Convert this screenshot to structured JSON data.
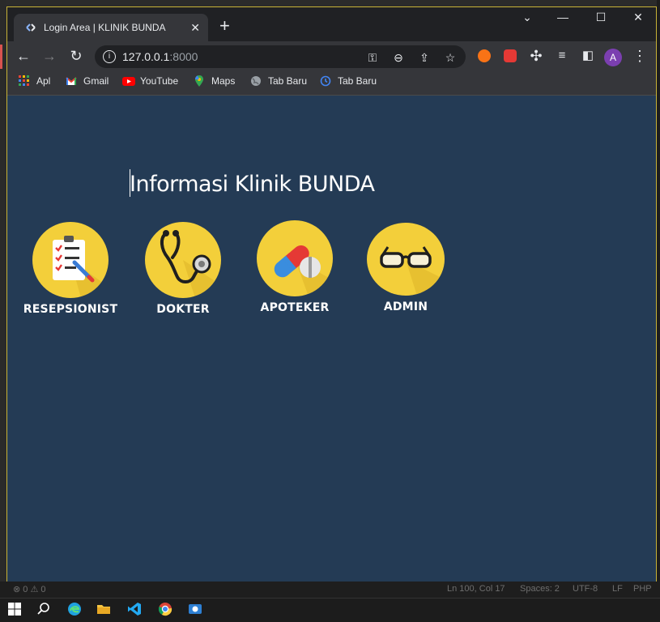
{
  "browser": {
    "tab_title": "Login Area | KLINIK BUNDA",
    "new_tab": "+",
    "url_host": "127.0.0.1",
    "url_port": ":8000",
    "profile_initial": "A"
  },
  "bookmarks": [
    {
      "label": "Apl",
      "icon": "apps-grid-icon"
    },
    {
      "label": "Gmail",
      "icon": "gmail-icon"
    },
    {
      "label": "YouTube",
      "icon": "youtube-icon"
    },
    {
      "label": "Maps",
      "icon": "maps-icon"
    },
    {
      "label": "Tab Baru",
      "icon": "globe-icon"
    },
    {
      "label": "Tab Baru",
      "icon": "history-icon"
    }
  ],
  "page": {
    "title": "Informasi Klinik BUNDA",
    "roles": [
      {
        "label": "RESEPSIONIST",
        "icon": "clipboard-checklist-icon"
      },
      {
        "label": "DOKTER",
        "icon": "stethoscope-icon"
      },
      {
        "label": "APOTEKER",
        "icon": "pill-capsule-icon"
      },
      {
        "label": "ADMIN",
        "icon": "glasses-icon"
      }
    ]
  },
  "statusbar": {
    "left": "⊗ 0 ⚠ 0",
    "position": "Ln 100, Col 17",
    "spaces": "Spaces: 2",
    "encoding": "UTF-8",
    "eol": "LF",
    "language": "PHP"
  },
  "colors": {
    "page_background": "#243b55",
    "icon_circle": "#f3cf3a",
    "browser_frame": "#202124"
  }
}
